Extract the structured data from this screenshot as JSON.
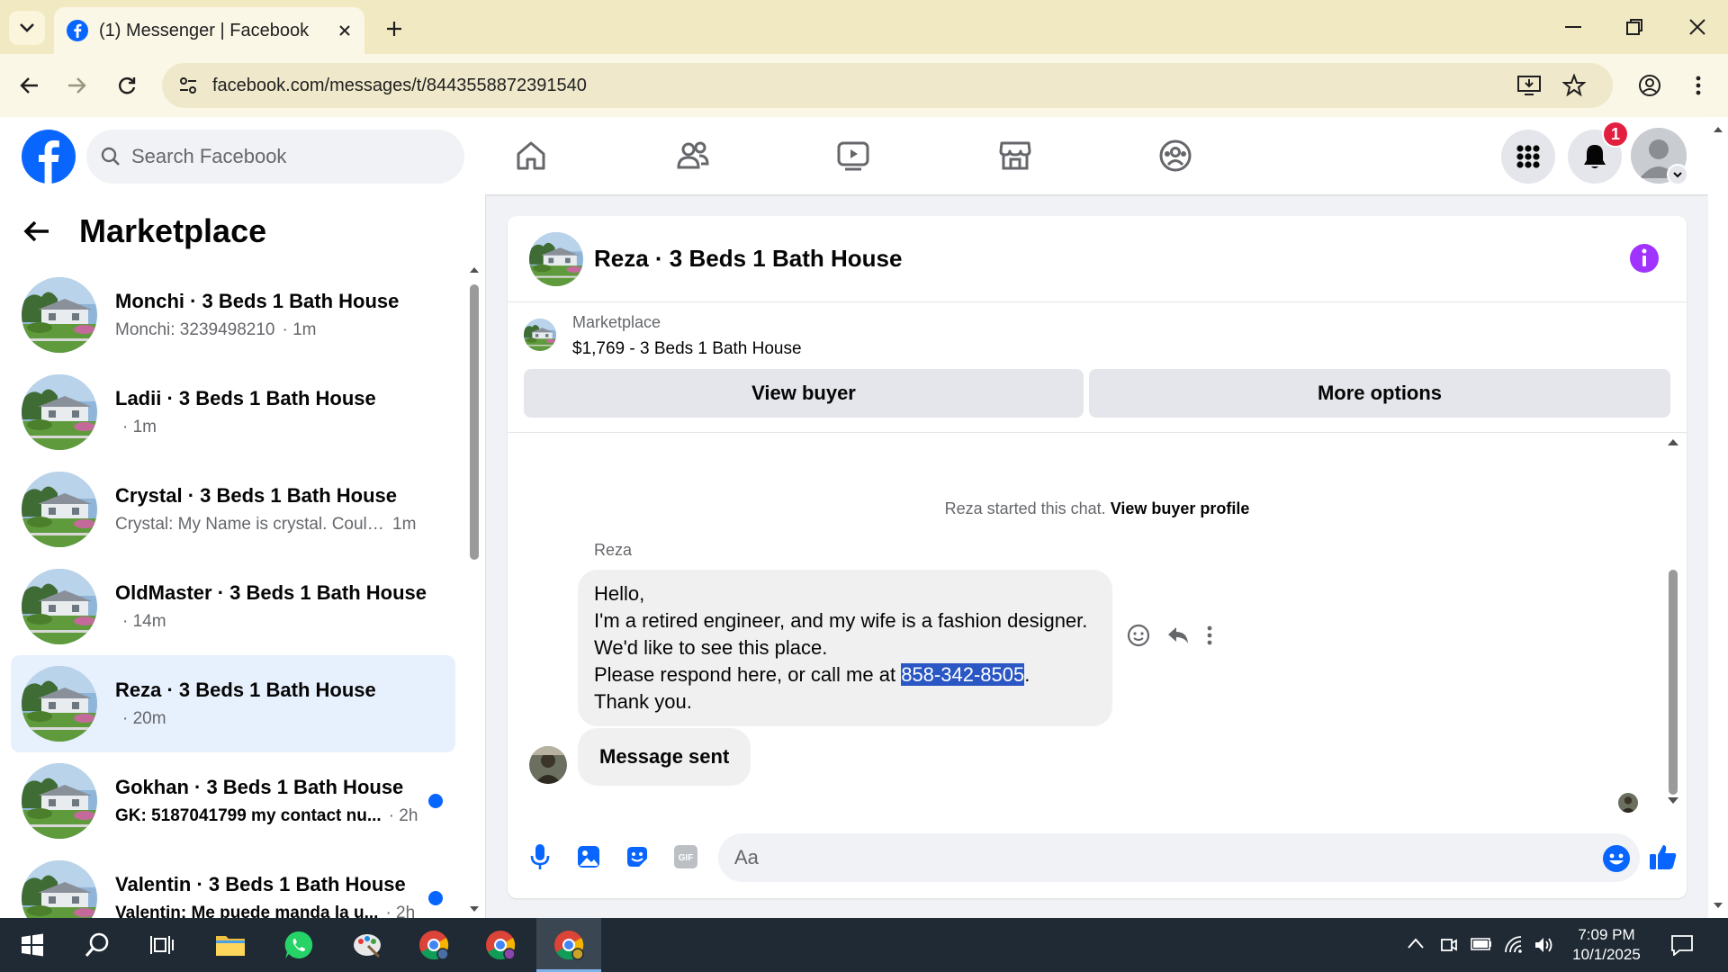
{
  "browser": {
    "tab_title": "(1) Messenger | Facebook",
    "url": "facebook.com/messages/t/8443558872391540"
  },
  "fb": {
    "search_placeholder": "Search Facebook",
    "notification_count": "1",
    "brand_color": "#0866ff"
  },
  "sidebar": {
    "title": "Marketplace",
    "conversations": [
      {
        "name": "Monchi · 3 Beds 1 Bath House",
        "preview": "Monchi: 3239498210",
        "time": "· 1m",
        "unread": false,
        "active": false
      },
      {
        "name": "Ladii · 3 Beds 1 Bath House",
        "preview": "",
        "time": "· 1m",
        "unread": false,
        "active": false
      },
      {
        "name": "Crystal · 3 Beds 1 Bath House",
        "preview": "Crystal: My Name is crystal. Could ...",
        "time": "1m",
        "unread": false,
        "active": false
      },
      {
        "name": "OldMaster · 3 Beds 1 Bath House",
        "preview": "",
        "time": "· 14m",
        "unread": false,
        "active": false
      },
      {
        "name": "Reza · 3 Beds 1 Bath House",
        "preview": "",
        "time": "· 20m",
        "unread": false,
        "active": true
      },
      {
        "name": "Gokhan · 3 Beds 1 Bath House",
        "preview": "GK: 5187041799 my contact nu...",
        "time": "· 2h",
        "unread": true,
        "active": false
      },
      {
        "name": "Valentin · 3 Beds 1 Bath House",
        "preview": "Valentin: Me puede manda la u...",
        "time": "· 2h",
        "unread": true,
        "active": false
      }
    ]
  },
  "chat": {
    "title": "Reza · 3 Beds 1 Bath House",
    "listing_label": "Marketplace",
    "listing_price": "$1,769 - 3 Beds 1 Bath House",
    "view_buyer": "View buyer",
    "more_options": "More options",
    "started_text": "Reza started this chat.",
    "view_buyer_profile": "View buyer profile",
    "sender": "Reza",
    "message_lines": [
      "Hello,",
      "I'm a retired engineer, and my wife is a fashion designer.",
      "We'd like to see this place.",
      "Please respond here, or call me at",
      "858-342-8505",
      ".",
      "Thank you."
    ],
    "status_message": "Message sent",
    "composer_placeholder": "Aa"
  },
  "taskbar": {
    "time": "7:09 PM",
    "date": "10/1/2025"
  }
}
